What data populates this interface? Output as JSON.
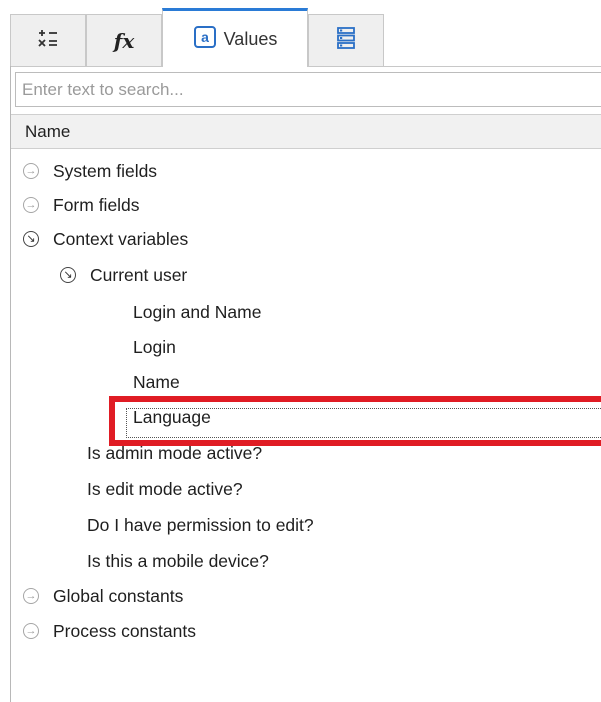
{
  "tabs": [
    {
      "label": "",
      "icon": "operators-icon"
    },
    {
      "label": "",
      "icon": "function-icon"
    },
    {
      "label": "Values",
      "icon": "values-icon"
    },
    {
      "label": "",
      "icon": "list-icon"
    }
  ],
  "active_tab": 2,
  "search": {
    "placeholder": "Enter text to search..."
  },
  "column_header": "Name",
  "tree": {
    "system_fields": "System fields",
    "form_fields": "Form fields",
    "context_variables": "Context variables",
    "current_user": "Current user",
    "login_and_name": "Login and Name",
    "login": "Login",
    "name": "Name",
    "language": "Language",
    "is_admin_mode_active": "Is admin mode active?",
    "is_edit_mode_active": "Is edit mode active?",
    "do_i_have_permission": "Do I have permission to edit?",
    "is_mobile_device": "Is this a mobile device?",
    "global_constants": "Global constants",
    "process_constants": "Process constants"
  },
  "colors": {
    "active_tab_accent": "#2a7bd6",
    "highlight": "#e01c24"
  }
}
